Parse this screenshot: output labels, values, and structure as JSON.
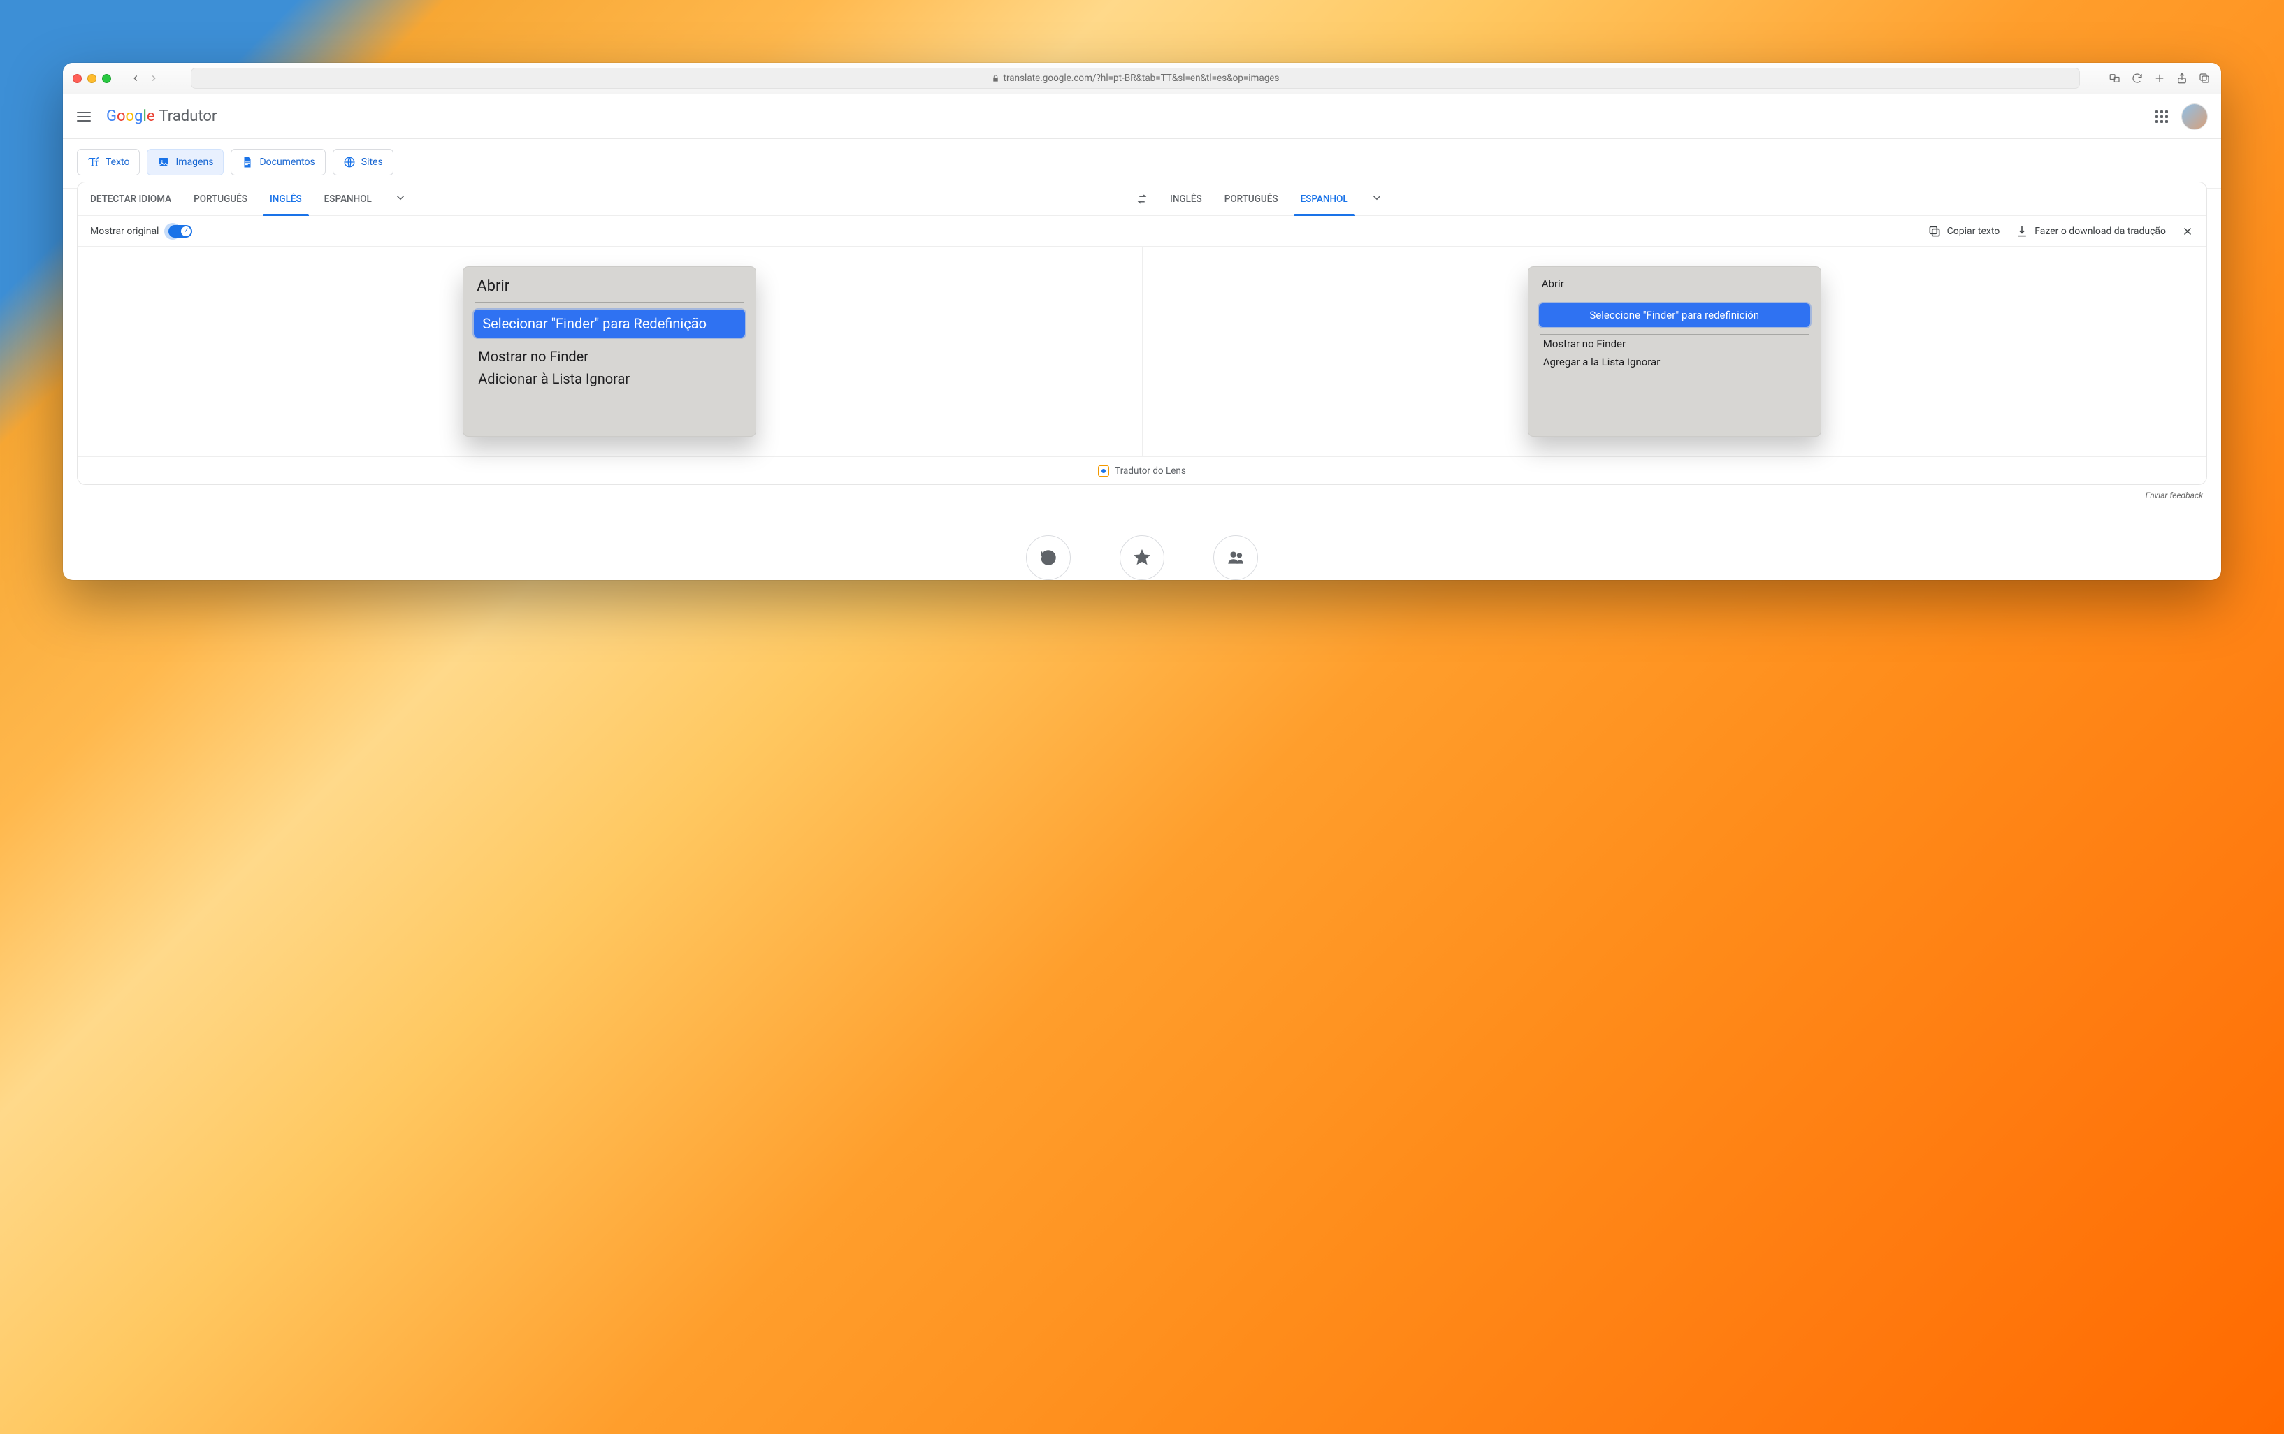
{
  "browser": {
    "url": "translate.google.com/?hl=pt-BR&tab=TT&sl=en&tl=es&op=images"
  },
  "header": {
    "product_name": "Tradutor"
  },
  "modes": {
    "text": "Texto",
    "images": "Imagens",
    "documents": "Documentos",
    "sites": "Sites"
  },
  "languages": {
    "source": {
      "detect": "DETECTAR IDIOMA",
      "pt": "PORTUGUÊS",
      "en": "INGLÊS",
      "es": "ESPANHOL",
      "active": "en"
    },
    "target": {
      "en": "INGLÊS",
      "pt": "PORTUGUÊS",
      "es": "ESPANHOL",
      "active": "es"
    }
  },
  "actions": {
    "show_original": "Mostrar original",
    "copy": "Copiar texto",
    "download": "Fazer o download da tradução"
  },
  "source_menu": {
    "title": "Abrir",
    "selected": "Selecionar \"Finder\" para Redefinição",
    "item1": "Mostrar no Finder",
    "item2": "Adicionar à Lista Ignorar"
  },
  "target_menu": {
    "title": "Abrir",
    "selected": "Seleccione \"Finder\" para redefinición",
    "item1": "Mostrar no Finder",
    "item2": "Agregar a la Lista Ignorar"
  },
  "lens": "Tradutor do Lens",
  "feedback": "Enviar feedback"
}
